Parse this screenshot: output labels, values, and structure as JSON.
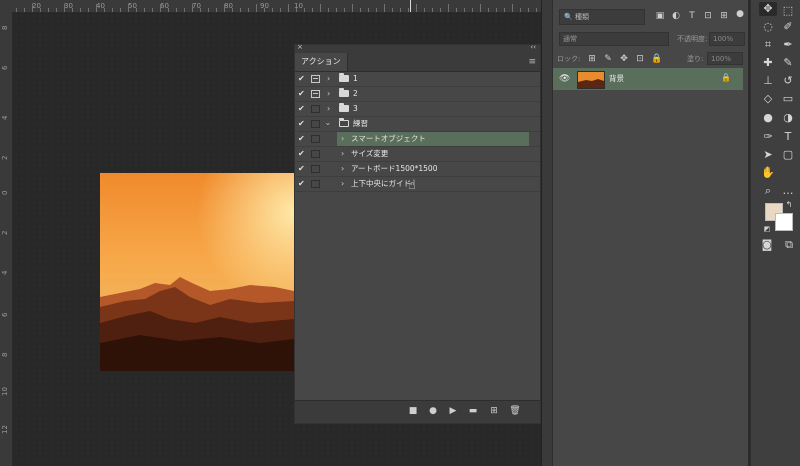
{
  "ruler": {
    "top_labels": [
      "20",
      "30",
      "40",
      "50",
      "60",
      "70",
      "80",
      "90",
      "10"
    ],
    "left_labels": [
      "8",
      "6",
      "4",
      "2",
      "0",
      "2",
      "4",
      "6",
      "8",
      "10",
      "12"
    ]
  },
  "actions_panel": {
    "close_glyph": "×",
    "collapse_glyph": "‹‹",
    "tab_label": "アクション",
    "menu_glyph": "≡",
    "items": [
      {
        "label": "1",
        "type": "set",
        "checked": true,
        "dialog": true
      },
      {
        "label": "2",
        "type": "set",
        "checked": true,
        "dialog": true
      },
      {
        "label": "3",
        "type": "set",
        "checked": true,
        "dialog": false
      },
      {
        "label": "練習",
        "type": "set-open",
        "checked": true,
        "dialog": false
      },
      {
        "label": "スマートオブジェクト",
        "type": "action",
        "checked": true,
        "selected": true
      },
      {
        "label": "サイズ変更",
        "type": "action",
        "checked": true
      },
      {
        "label": "アートボード1500*1500",
        "type": "action",
        "checked": true
      },
      {
        "label": "上下中央にガイド",
        "type": "action",
        "checked": true
      }
    ],
    "footer_buttons": [
      "stop",
      "record",
      "play",
      "new-set",
      "new-action",
      "delete"
    ]
  },
  "layers_panel": {
    "kind_label": "種類",
    "blend_mode": "通常",
    "opacity_label": "不透明度:",
    "opacity_value": "100%",
    "lock_label": "ロック:",
    "fill_label": "塗り:",
    "fill_value": "100%",
    "layer_name": "背景"
  },
  "colors": {
    "foreground": "#ead8c4",
    "background": "#ffffff",
    "selection": "#5a6e5c"
  },
  "tools": [
    "move-icon",
    "marquee-icon",
    "lasso-icon",
    "quick-select-icon",
    "crop-icon",
    "eyedropper-icon",
    "healing-icon",
    "brush-icon",
    "stamp-icon",
    "history-brush-icon",
    "eraser-icon",
    "gradient-icon",
    "blur-icon",
    "dodge-icon",
    "pen-icon",
    "type-icon",
    "path-select-icon",
    "rectangle-icon",
    "hand-icon",
    "zoom-icon",
    "more-icon"
  ]
}
